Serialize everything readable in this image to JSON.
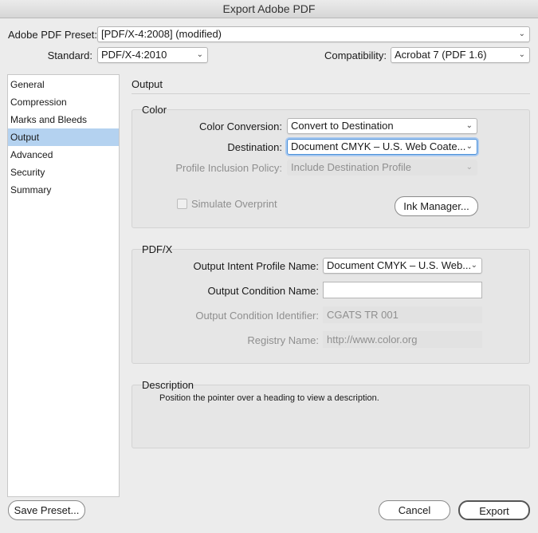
{
  "window": {
    "title": "Export Adobe PDF"
  },
  "preset": {
    "label": "Adobe PDF Preset:",
    "value": "[PDF/X-4:2008] (modified)"
  },
  "standard": {
    "label": "Standard:",
    "value": "PDF/X-4:2010"
  },
  "compatibility": {
    "label": "Compatibility:",
    "value": "Acrobat 7 (PDF 1.6)"
  },
  "sidebar": {
    "items": [
      {
        "label": "General"
      },
      {
        "label": "Compression"
      },
      {
        "label": "Marks and Bleeds"
      },
      {
        "label": "Output",
        "selected": true
      },
      {
        "label": "Advanced"
      },
      {
        "label": "Security"
      },
      {
        "label": "Summary"
      }
    ]
  },
  "section": {
    "title": "Output"
  },
  "color": {
    "title": "Color",
    "conversion_label": "Color Conversion:",
    "conversion_value": "Convert to Destination",
    "destination_label": "Destination:",
    "destination_value": "Document CMYK – U.S. Web Coate...",
    "profile_label": "Profile Inclusion Policy:",
    "profile_value": "Include Destination Profile",
    "simulate_label": "Simulate Overprint",
    "simulate_checked": false,
    "ink_manager_label": "Ink Manager..."
  },
  "pdfx": {
    "title": "PDF/X",
    "intent_label": "Output Intent Profile Name:",
    "intent_value": "Document CMYK – U.S. Web...",
    "condition_name_label": "Output Condition Name:",
    "condition_name_value": "",
    "condition_id_label": "Output Condition Identifier:",
    "condition_id_value": "CGATS TR 001",
    "registry_label": "Registry Name:",
    "registry_value": "http://www.color.org"
  },
  "description": {
    "title": "Description",
    "text": "Position the pointer over a heading to view a description."
  },
  "footer": {
    "save_preset_label": "Save Preset...",
    "cancel_label": "Cancel",
    "export_label": "Export"
  },
  "icons": {
    "dropdown": "chevron-down-icon"
  },
  "colors": {
    "selection": "#b4d2f0",
    "focus": "#4a90d9"
  }
}
